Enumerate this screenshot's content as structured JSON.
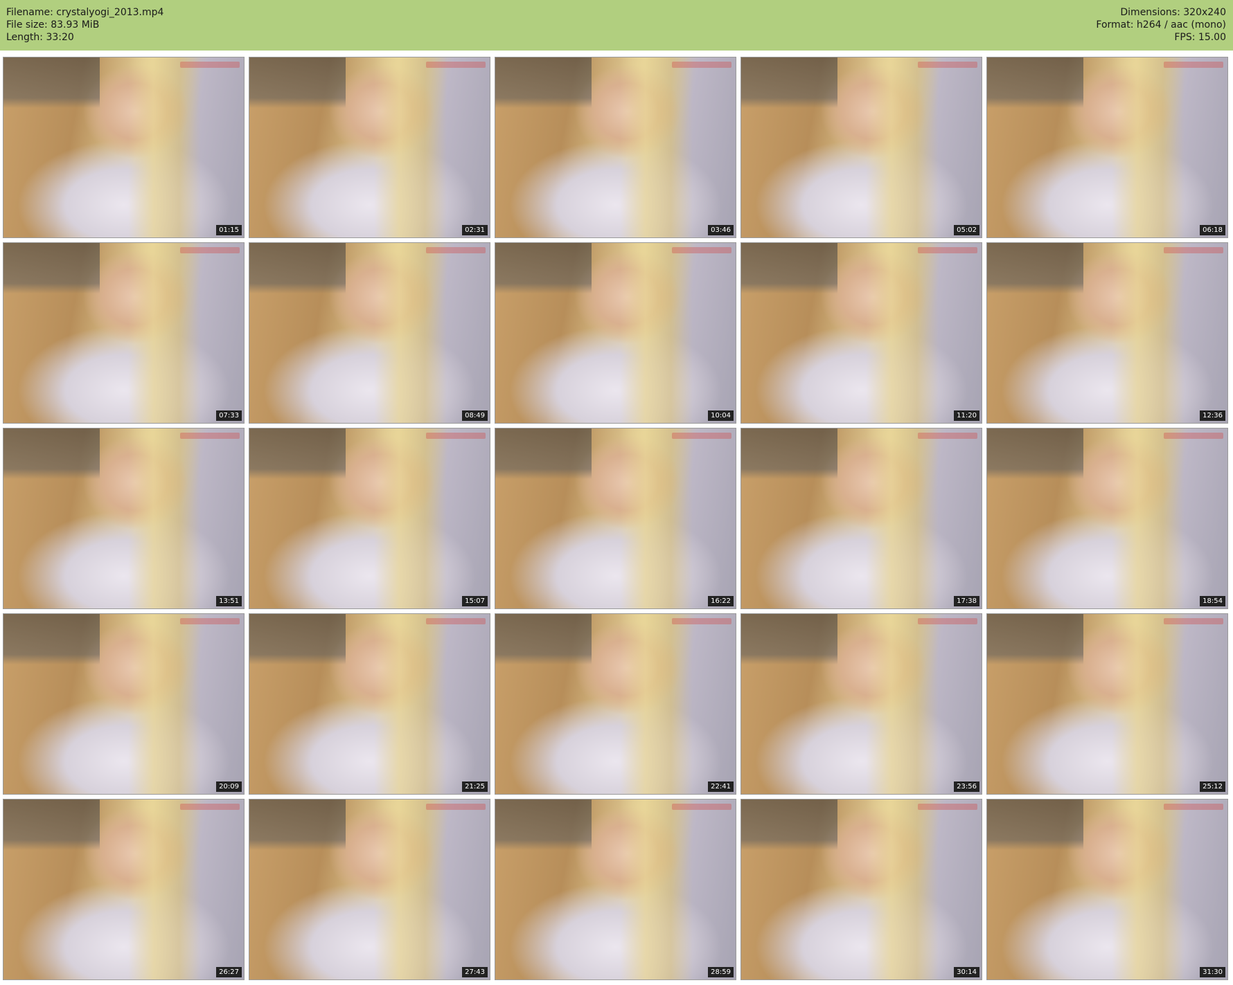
{
  "header": {
    "filename": "Filename: crystalyogi_2013.mp4",
    "filesize": "File size: 83.93 MiB",
    "length": "Length: 33:20",
    "dimensions": "Dimensions: 320x240",
    "format": "Format: h264 / aac (mono)",
    "fps": "FPS: 15.00"
  },
  "thumbnails": [
    {
      "time": "01:15"
    },
    {
      "time": "02:31"
    },
    {
      "time": "03:46"
    },
    {
      "time": "05:02"
    },
    {
      "time": "06:18"
    },
    {
      "time": "07:33"
    },
    {
      "time": "08:49"
    },
    {
      "time": "10:04"
    },
    {
      "time": "11:20"
    },
    {
      "time": "12:36"
    },
    {
      "time": "13:51"
    },
    {
      "time": "15:07"
    },
    {
      "time": "16:22"
    },
    {
      "time": "17:38"
    },
    {
      "time": "18:54"
    },
    {
      "time": "20:09"
    },
    {
      "time": "21:25"
    },
    {
      "time": "22:41"
    },
    {
      "time": "23:56"
    },
    {
      "time": "25:12"
    },
    {
      "time": "26:27"
    },
    {
      "time": "27:43"
    },
    {
      "time": "28:59"
    },
    {
      "time": "30:14"
    },
    {
      "time": "31:30"
    }
  ],
  "colors": {
    "header_bg": "#b1cf7f",
    "timestamp_bg": "#222222"
  }
}
